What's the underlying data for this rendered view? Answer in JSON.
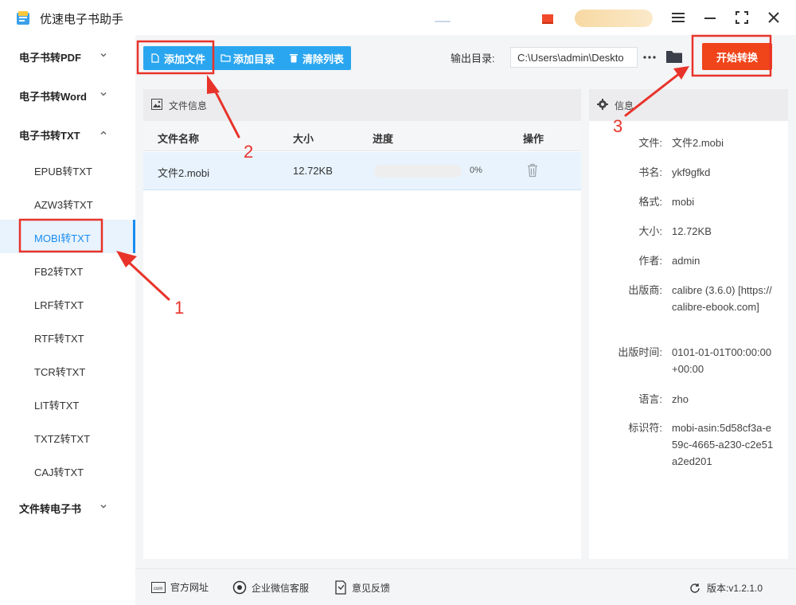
{
  "app": {
    "title": "优速电子书助手"
  },
  "sidebar": {
    "groups": [
      {
        "label": "电子书转PDF",
        "expanded": false
      },
      {
        "label": "电子书转Word",
        "expanded": false
      },
      {
        "label": "电子书转TXT",
        "expanded": true
      },
      {
        "label": "文件转电子书",
        "expanded": false
      }
    ],
    "items": [
      {
        "label": "EPUB转TXT"
      },
      {
        "label": "AZW3转TXT"
      },
      {
        "label": "MOBI转TXT",
        "active": true
      },
      {
        "label": "FB2转TXT"
      },
      {
        "label": "LRF转TXT"
      },
      {
        "label": "RTF转TXT"
      },
      {
        "label": "TCR转TXT"
      },
      {
        "label": "LIT转TXT"
      },
      {
        "label": "TXTZ转TXT"
      },
      {
        "label": "CAJ转TXT"
      }
    ]
  },
  "toolbar": {
    "add_file": "添加文件",
    "add_dir": "添加目录",
    "clear_list": "清除列表",
    "output_label": "输出目录:",
    "output_path": "C:\\Users\\admin\\Deskto",
    "more_label": "···",
    "start_button": "开始转换"
  },
  "file_panel": {
    "title": "文件信息",
    "columns": {
      "name": "文件名称",
      "size": "大小",
      "progress": "进度",
      "action": "操作"
    },
    "rows": [
      {
        "name": "文件2.mobi",
        "size": "12.72KB",
        "progress": 0,
        "progress_text": "0%"
      }
    ]
  },
  "info_panel": {
    "title": "信息",
    "fields": [
      {
        "key": "文件:",
        "value": "文件2.mobi"
      },
      {
        "key": "书名:",
        "value": "ykf9gfkd"
      },
      {
        "key": "格式:",
        "value": "mobi"
      },
      {
        "key": "大小:",
        "value": "12.72KB"
      },
      {
        "key": "作者:",
        "value": "admin"
      },
      {
        "key": "出版商:",
        "value": "calibre (3.6.0) [https://calibre-ebook.com]"
      },
      {
        "key": "出版时间:",
        "value": "0101-01-01T00:00:00+00:00"
      },
      {
        "key": "语言:",
        "value": "zho"
      },
      {
        "key": "标识符:",
        "value": "mobi-asin:5d58cf3a-e59c-4665-a230-c2e51a2ed201"
      }
    ]
  },
  "footer": {
    "website": "官方网址",
    "wechat_service": "企业微信客服",
    "feedback": "意见反馈",
    "version": "版本:v1.2.1.0"
  },
  "annotations": {
    "step1": "1",
    "step2": "2",
    "step3": "3"
  },
  "colors": {
    "accent": "#2aa6f0",
    "start": "#f0441a",
    "annotation": "#e8332a",
    "active_text": "#1a8cf0"
  }
}
